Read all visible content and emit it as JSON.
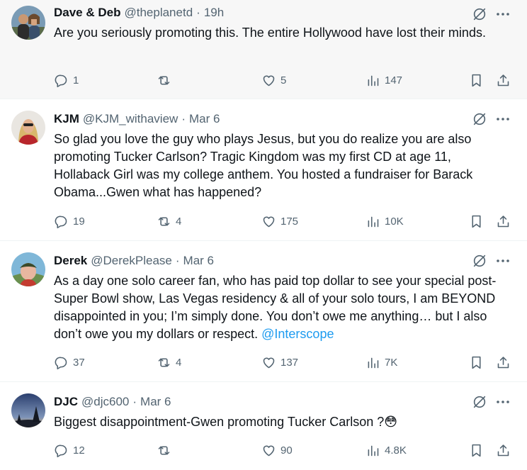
{
  "tweets": [
    {
      "name": "Dave & Deb",
      "handle": "@theplanetd",
      "dot": "·",
      "time": "19h",
      "text": "Are you seriously promoting this. The entire Hollywood have lost their minds.",
      "replies": "1",
      "retweets": "",
      "likes": "5",
      "views": "147"
    },
    {
      "name": "KJM",
      "handle": "@KJM_withaview",
      "dot": "·",
      "time": "Mar 6",
      "text": "So glad you love the guy who plays Jesus, but you do realize you are also promoting Tucker Carlson?  Tragic Kingdom was my first CD at age 11, Hollaback Girl was my college anthem. You hosted a fundraiser for Barack Obama...Gwen what has happened?",
      "replies": "19",
      "retweets": "4",
      "likes": "175",
      "views": "10K"
    },
    {
      "name": "Derek",
      "handle": "@DerekPlease",
      "dot": "·",
      "time": "Mar 6",
      "text": "As a day one solo career fan, who has paid top dollar to see your special post-Super Bowl show, Las Vegas residency & all of your solo tours, I am BEYOND disappointed in you; I’m simply done. You don’t owe me anything… but I also don’t owe you my dollars or respect. ",
      "mention": "@Interscope",
      "replies": "37",
      "retweets": "4",
      "likes": "137",
      "views": "7K"
    },
    {
      "name": "DJC",
      "handle": "@djc600",
      "dot": "·",
      "time": "Mar 6",
      "text": "Biggest disappointment-Gwen promoting Tucker Carlson ?😳",
      "replies": "12",
      "retweets": "",
      "likes": "90",
      "views": "4.8K"
    }
  ],
  "colors": {
    "text": "#0f1419",
    "secondary": "#536471",
    "link": "#1d9bf0",
    "highlight_bg": "#f7f7f7"
  },
  "icons": [
    "reply-icon",
    "retweet-icon",
    "like-icon",
    "views-icon",
    "bookmark-icon",
    "share-icon",
    "grok-icon",
    "more-icon"
  ]
}
